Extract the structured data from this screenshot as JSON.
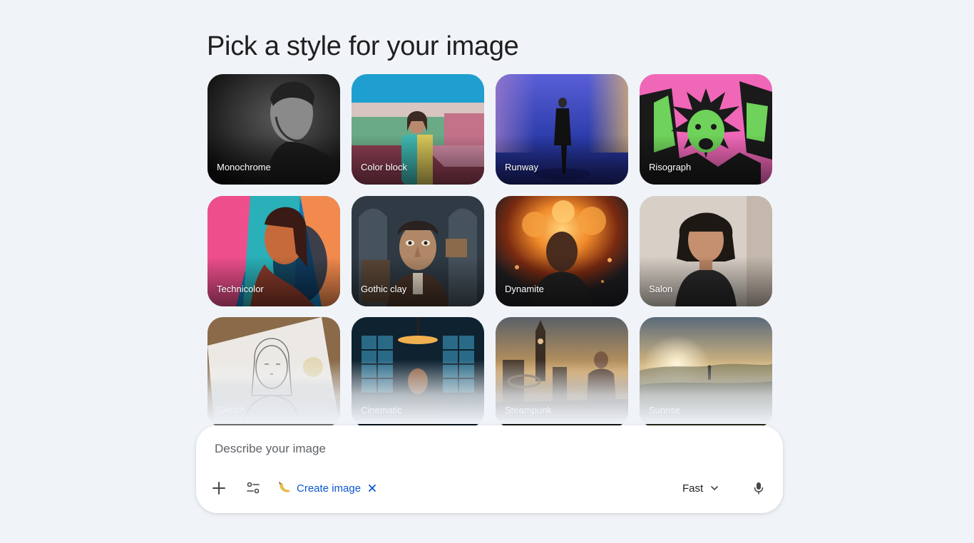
{
  "header": {
    "title": "Pick a style for your image"
  },
  "styles": [
    {
      "label": "Monochrome"
    },
    {
      "label": "Color block"
    },
    {
      "label": "Runway"
    },
    {
      "label": "Risograph"
    },
    {
      "label": "Technicolor"
    },
    {
      "label": "Gothic clay"
    },
    {
      "label": "Dynamite"
    },
    {
      "label": "Salon"
    },
    {
      "label": "Sketch"
    },
    {
      "label": "Cinematic"
    },
    {
      "label": "Steampunk"
    },
    {
      "label": "Sunrise"
    }
  ],
  "prompt": {
    "placeholder": "Describe your image",
    "value": "",
    "tool_chip": {
      "label": "Create image",
      "icon": "banana-icon"
    },
    "mode": {
      "label": "Fast"
    }
  },
  "colors": {
    "background": "#f0f4f9",
    "accent": "#0b57d0"
  }
}
